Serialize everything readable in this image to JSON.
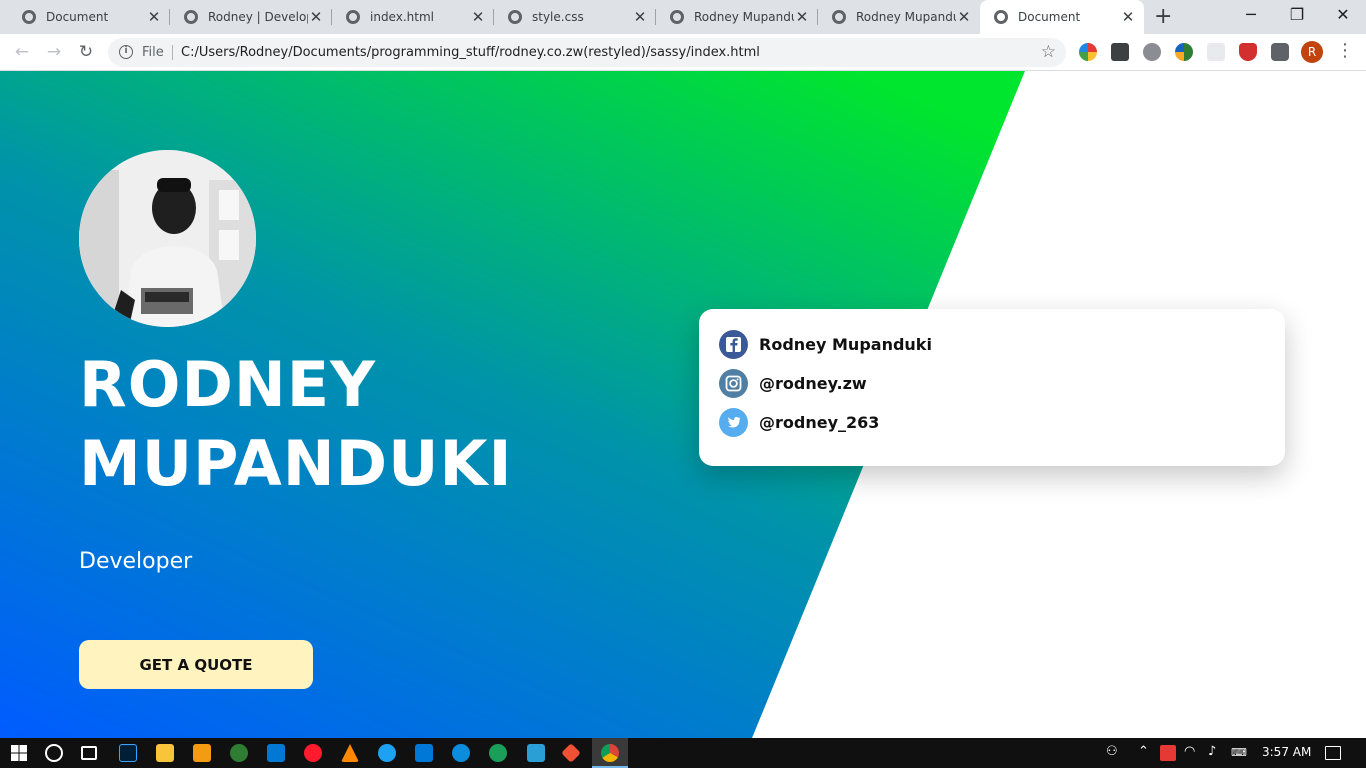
{
  "browser": {
    "tabs": [
      {
        "title": "Document",
        "active": false
      },
      {
        "title": "Rodney | Developer",
        "active": false
      },
      {
        "title": "index.html",
        "active": false
      },
      {
        "title": "style.css",
        "active": false
      },
      {
        "title": "Rodney Mupanduki",
        "active": false
      },
      {
        "title": "Rodney Mupanduki",
        "active": false
      },
      {
        "title": "Document",
        "active": true
      }
    ],
    "tab_close_glyph": "✕",
    "new_tab_glyph": "+",
    "window_controls": {
      "minimize": "─",
      "maximize": "❐",
      "close": "✕"
    },
    "nav": {
      "back": "←",
      "forward": "→",
      "reload": "↻"
    },
    "omnibox": {
      "info_glyph": "i",
      "scheme_label": "File",
      "url": "C:/Users/Rodney/Documents/programming_stuff/rodney.co.zw(restyled)/sassy/index.html",
      "bookmark_glyph": "☆"
    },
    "profile_initial": "R",
    "menu_glyph": "⋮"
  },
  "hero": {
    "name_line1": "RODNEY",
    "name_line2": "MUPANDUKI",
    "role": "Developer",
    "cta_label": "GET A QUOTE",
    "gradient": {
      "start": "#005cff",
      "mid": "#0094a8",
      "end": "#00e52e"
    },
    "cta_color": "#fff3bf"
  },
  "social": [
    {
      "network": "facebook",
      "icon": "facebook-icon",
      "text": "Rodney Mupanduki",
      "color": "#3b5998"
    },
    {
      "network": "instagram",
      "icon": "instagram-icon",
      "text": "@rodney.zw",
      "color": "#517fa4"
    },
    {
      "network": "twitter",
      "icon": "twitter-icon",
      "text": "@rodney_263",
      "color": "#55acee"
    }
  ],
  "taskbar": {
    "clock": "3:57 AM",
    "apps": [
      "windows-start-icon",
      "cortana-icon",
      "task-view-icon",
      "photoshop-icon",
      "file-explorer-icon",
      "media-player-icon",
      "chrome-dev-icon",
      "mail-icon",
      "opera-icon",
      "vlc-icon",
      "twitter-app-icon",
      "vscode-icon",
      "edge-icon",
      "edge-dev-icon",
      "snipping-icon",
      "git-icon",
      "chrome-icon"
    ]
  }
}
